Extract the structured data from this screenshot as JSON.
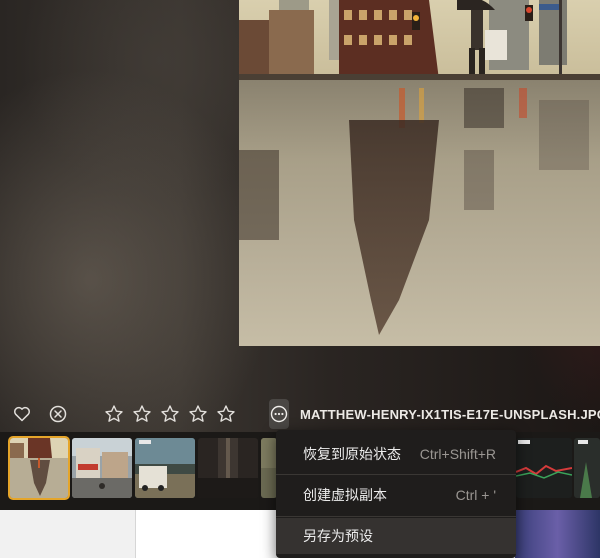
{
  "toolbar": {
    "like_icon": "heart-icon",
    "reject_icon": "circle-x-icon",
    "rating": 0,
    "rating_max": 5,
    "star_icon": "star-outline-icon",
    "more_icon": "ellipsis-circle-icon",
    "filename": "MATTHEW-HENRY-IX1TIS-E17E-UNSPLASH.JPG"
  },
  "filmstrip": {
    "selected_index": 0,
    "selection_color": "#e5a52a"
  },
  "context_menu": {
    "items": [
      {
        "label": "恢复到原始状态",
        "shortcut": "Ctrl+Shift+R"
      },
      {
        "label": "创建虚拟副本",
        "shortcut": "Ctrl + '"
      },
      {
        "label": "另存为预设",
        "shortcut": ""
      }
    ],
    "hovered_index": 2
  }
}
